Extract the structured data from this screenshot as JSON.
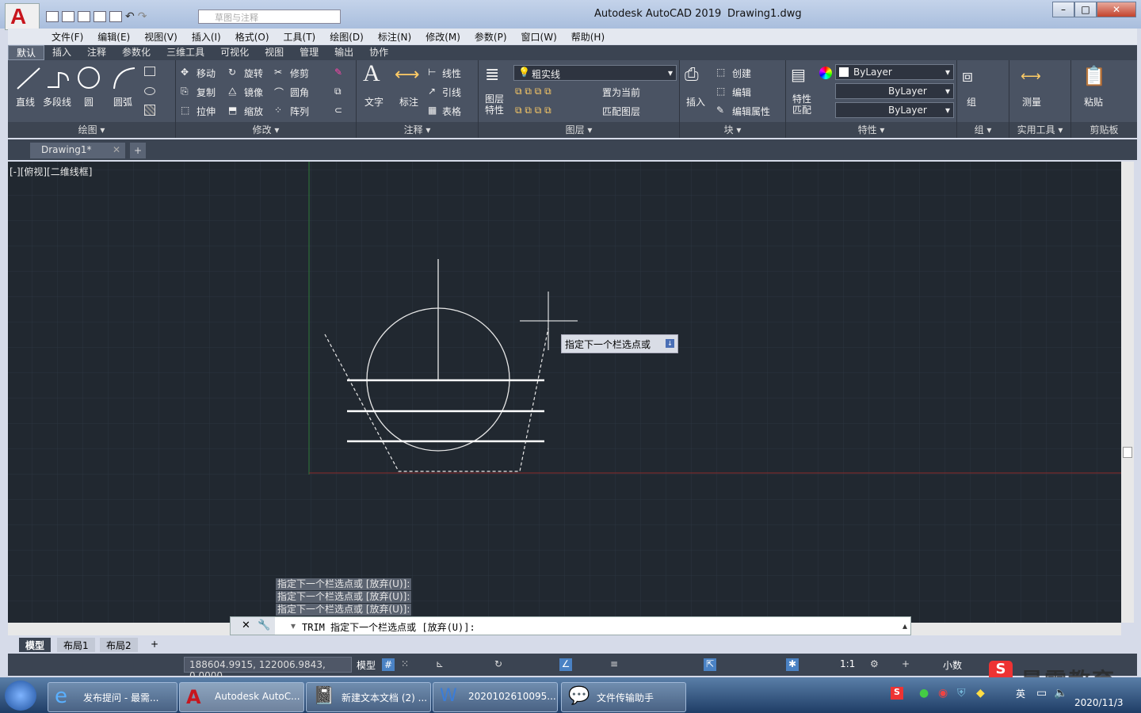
{
  "window": {
    "app_title": "Autodesk AutoCAD 2019",
    "doc_title": "Drawing1.dwg",
    "workspace": "草图与注释"
  },
  "menu": [
    "文件(F)",
    "编辑(E)",
    "视图(V)",
    "插入(I)",
    "格式(O)",
    "工具(T)",
    "绘图(D)",
    "标注(N)",
    "修改(M)",
    "参数(P)",
    "窗口(W)",
    "帮助(H)"
  ],
  "ribbon_tabs": [
    "默认",
    "插入",
    "注释",
    "参数化",
    "三维工具",
    "可视化",
    "视图",
    "管理",
    "输出",
    "协作"
  ],
  "ribbon": {
    "draw": {
      "title": "绘图",
      "line": "直线",
      "polyline": "多段线",
      "circle": "圆",
      "arc": "圆弧"
    },
    "modify": {
      "title": "修改",
      "move": "移动",
      "rotate": "旋转",
      "trim": "修剪",
      "copy": "复制",
      "mirror": "镜像",
      "fillet": "圆角",
      "stretch": "拉伸",
      "scale": "缩放",
      "array": "阵列"
    },
    "annotation": {
      "title": "注释",
      "text": "文字",
      "dimension": "标注",
      "linear": "线性",
      "leader": "引线",
      "table": "表格"
    },
    "layers": {
      "title": "图层",
      "properties": "图层\n特性",
      "current_layer": "粗实线",
      "set_current": "置为当前",
      "match_layer": "匹配图层"
    },
    "block": {
      "title": "块",
      "insert": "插入",
      "create": "创建",
      "edit": "编辑",
      "edit_attr": "编辑属性"
    },
    "properties": {
      "title": "特性",
      "match": "特性\n匹配",
      "color": "ByLayer",
      "linetype": "ByLayer",
      "lineweight": "ByLayer"
    },
    "groups": {
      "title": "组",
      "group": "组"
    },
    "utilities": {
      "title": "实用工具",
      "measure": "测量"
    },
    "clipboard": {
      "title": "剪贴板",
      "paste": "粘贴"
    }
  },
  "doc_tab": "Drawing1*",
  "viewport_label": "[-][俯视][二维线框]",
  "tooltip": "指定下一个栏选点或",
  "command_history": [
    "指定下一个栏选点或 [放弃(U)]:",
    "指定下一个栏选点或 [放弃(U)]:",
    "指定下一个栏选点或 [放弃(U)]:"
  ],
  "command_line": "TRIM 指定下一个栏选点或 [放弃(U)]:",
  "layout_tabs": [
    "模型",
    "布局1",
    "布局2"
  ],
  "status": {
    "coords": "188604.9915, 122006.9843, 0.0000",
    "model": "模型",
    "scale": "1:1",
    "units": "小数"
  },
  "taskbar": {
    "buttons": [
      "发布提问 - 最需...",
      "Autodesk AutoC...",
      "新建文本文档 (2) ...",
      "2020102610095...",
      "文件传输助手"
    ],
    "time": "2020/11/3",
    "ime": "英"
  },
  "watermark": "最需教育",
  "colors": {
    "canvas": "#212830",
    "ribbon": "#4a5363",
    "accent": "#c8161d"
  }
}
